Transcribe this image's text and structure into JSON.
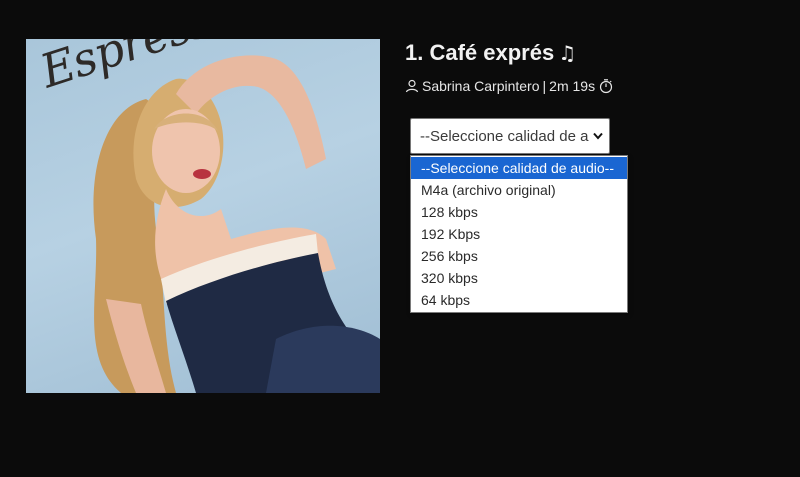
{
  "album": {
    "cover_script_text": "Espresso",
    "cover_bg_color": "#b7d1e3"
  },
  "track": {
    "title": "1. Café exprés",
    "title_icon": "music-note-icon",
    "artist": "Sabrina Carpintero",
    "separator": "|",
    "duration": "2m 19s",
    "artist_icon": "user-icon",
    "duration_icon": "stopwatch-icon"
  },
  "quality_select": {
    "current_value": "--Seleccione calidad de a",
    "options": [
      "--Seleccione calidad de audio--",
      "M4a (archivo original)",
      "128 kbps",
      "192 Kbps",
      "256 kbps",
      "320 kbps",
      "64 kbps"
    ],
    "highlighted_index": 0
  },
  "colors": {
    "background": "#0b0b0b",
    "highlight": "#1a66d2",
    "text": "#f2f2f2"
  }
}
